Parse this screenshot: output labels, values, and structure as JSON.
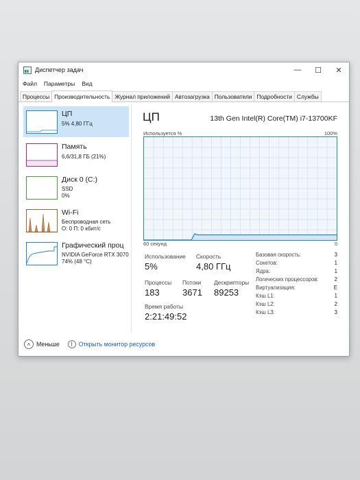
{
  "window": {
    "title": "Диспетчер задач",
    "controls": [
      "—",
      "☐",
      "✕"
    ]
  },
  "menu": [
    "Файл",
    "Параметры",
    "Вид"
  ],
  "tabs": [
    "Процессы",
    "Производительность",
    "Журнал приложений",
    "Автозагрузка",
    "Пользователи",
    "Подробности",
    "Службы"
  ],
  "active_tab": "Производительность",
  "sidebar": [
    {
      "name": "ЦП",
      "line1": "5% 4,80 ГГц",
      "line2": "",
      "color": "#1f86c8"
    },
    {
      "name": "Память",
      "line1": "6,6/31,8 ГБ (21%)",
      "line2": "",
      "color": "#8b2e8b"
    },
    {
      "name": "Диск 0 (C:)",
      "line1": "SSD",
      "line2": "0%",
      "color": "#4a9a3a"
    },
    {
      "name": "Wi-Fi",
      "line1": "Беспроводная сеть",
      "line2": "О: 0 П: 0 кбит/с",
      "color": "#a0612a"
    },
    {
      "name": "Графический проц",
      "line1": "NVIDIA GeForce RTX 3070",
      "line2": "74% (48 °C)",
      "color": "#1f86c8"
    }
  ],
  "main": {
    "title": "ЦП",
    "cpu_name": "13th Gen Intel(R) Core(TM) i7-13700KF",
    "graph_label_left": "Используется %",
    "graph_label_right": "100%",
    "graph_bottom_left": "60 секунд",
    "graph_bottom_right": "0",
    "graph_color": "#1f86c8",
    "usage_series": [
      0,
      0,
      0,
      0,
      0,
      0,
      0,
      0,
      0,
      0,
      0,
      0,
      0,
      0,
      0,
      0,
      6,
      5,
      5,
      5,
      5,
      5,
      5,
      5,
      5,
      5,
      5,
      5,
      5,
      5,
      5,
      5,
      5,
      5,
      5,
      5,
      5,
      5,
      5,
      5,
      5,
      5,
      5,
      5,
      5,
      5,
      5,
      5,
      5,
      5,
      5,
      5,
      5,
      5,
      5,
      5,
      5,
      5,
      5,
      5,
      5,
      5
    ],
    "usage_label": "Использование",
    "usage_value": "5%",
    "speed_label": "Скорость",
    "speed_value": "4,80 ГГц",
    "processes_label": "Процессы",
    "processes_value": "183",
    "threads_label": "Потоки",
    "threads_value": "3671",
    "descriptors_label": "Дескрипторы",
    "descriptors_value": "89253",
    "uptime_label": "Время работы",
    "uptime_value": "2:21:49:52",
    "props": [
      {
        "label": "Базовая скорость:",
        "value": "3"
      },
      {
        "label": "Сокетов:",
        "value": "1"
      },
      {
        "label": "Ядра:",
        "value": "1"
      },
      {
        "label": "Логических процессоров:",
        "value": "2"
      },
      {
        "label": "Виртуализация:",
        "value": "E"
      },
      {
        "label": "Кэш L1:",
        "value": "1"
      },
      {
        "label": "Кэш L2:",
        "value": "2"
      },
      {
        "label": "Кэш L3:",
        "value": "3"
      }
    ]
  },
  "footer": {
    "less_label": "Меньше",
    "monitor_label": "Открыть монитор ресурсов"
  }
}
